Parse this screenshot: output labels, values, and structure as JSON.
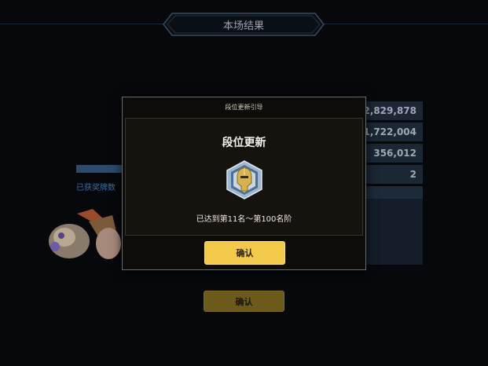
{
  "background": {
    "title": "本场结果",
    "stats": [
      "2,829,878",
      "1,722,004",
      "356,012",
      "2"
    ],
    "cards_label": "已获奖牌数",
    "confirm_label": "确认"
  },
  "modal": {
    "header": "段位更新引导",
    "title": "段位更新",
    "emblem_icon": "rank-emblem-icon",
    "description": "已达到第11名～第100名阶",
    "confirm_label": "确认"
  },
  "colors": {
    "accent_gold": "#f2c94b",
    "modal_border": "#7c6a3f"
  }
}
